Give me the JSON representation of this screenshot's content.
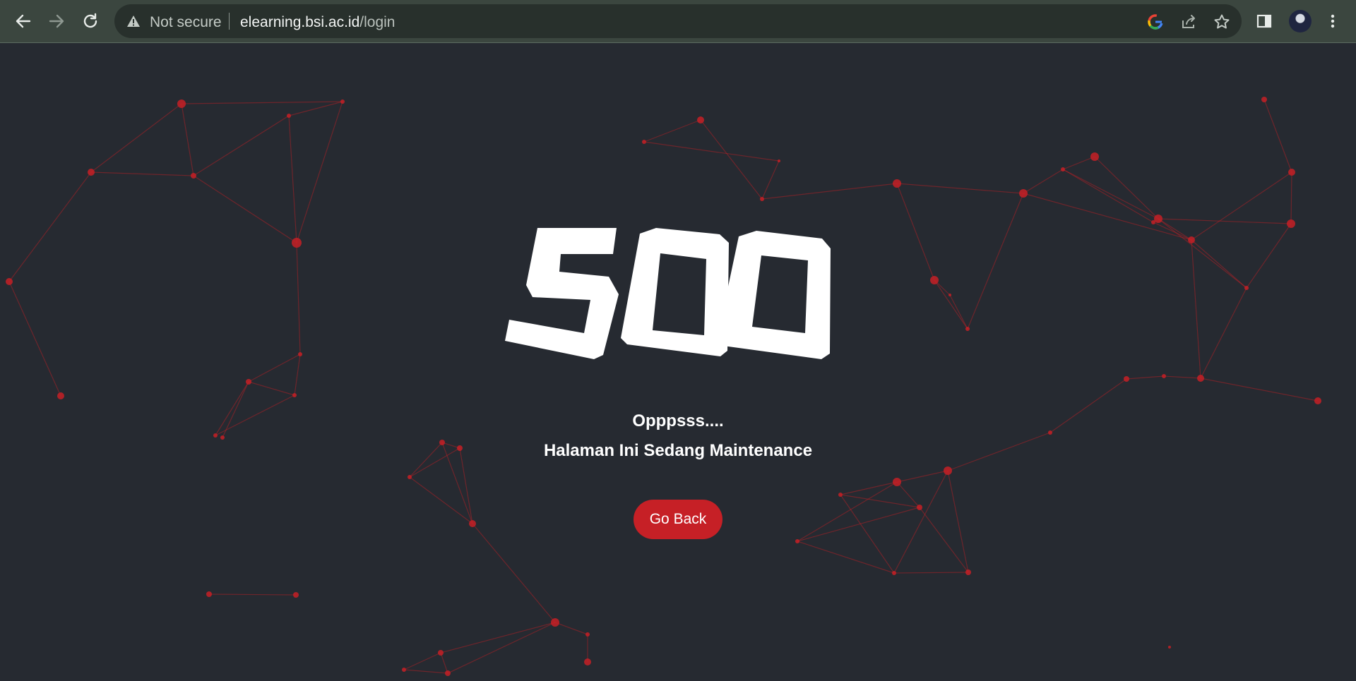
{
  "browser": {
    "security_label": "Not secure",
    "url_host": "elearning.bsi.ac.id",
    "url_path": "/login"
  },
  "page": {
    "error_code": "500",
    "title": "Opppsss....",
    "message": "Halaman Ini Sedang Maintenance",
    "button_label": "Go Back"
  },
  "colors": {
    "page_background": "#262a31",
    "accent_red": "#c62026",
    "text": "#ffffff"
  },
  "icons": {
    "back": "arrow-left-icon",
    "forward": "arrow-right-icon",
    "reload": "reload-icon",
    "warning": "warning-triangle-icon",
    "google": "google-lens-icon",
    "share": "share-icon",
    "bookmark": "star-icon",
    "side_panel": "side-panel-icon",
    "menu": "kebab-menu-icon"
  }
}
